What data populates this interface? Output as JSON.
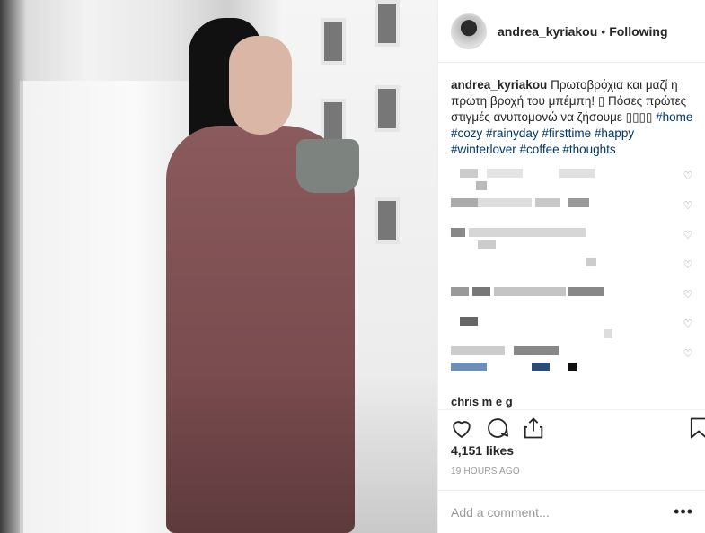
{
  "post": {
    "username": "andrea_kyriakou",
    "separator": "•",
    "follow_status": "Following"
  },
  "caption": {
    "user": "andrea_kyriakou",
    "text": "Πρωτοβρόχια και μαζί η πρώτη βροχή του μπέμπη! ▯ Πόσες πρώτες στιγμές ανυπομονώ να ζήσουμε ▯▯▯▯",
    "tags": [
      "#home",
      "#cozy",
      "#rainyday",
      "#firsttime",
      "#happy",
      "#winterlover",
      "#coffee",
      "#thoughts"
    ]
  },
  "comments": {
    "last_user": "chris m e g"
  },
  "engagement": {
    "likes": "4,151 likes",
    "time": "19 HOURS AGO"
  },
  "add_comment": {
    "placeholder": "Add a comment...",
    "more": "•••"
  },
  "icons": {
    "like": "heart-outline-icon",
    "comment": "comment-bubble-icon",
    "share": "share-upload-icon",
    "save": "bookmark-icon",
    "comment_like": "small-heart-icon"
  },
  "colors": {
    "hashtag": "#003569",
    "muted": "#999999",
    "text": "#262626",
    "divider": "#efefef"
  }
}
